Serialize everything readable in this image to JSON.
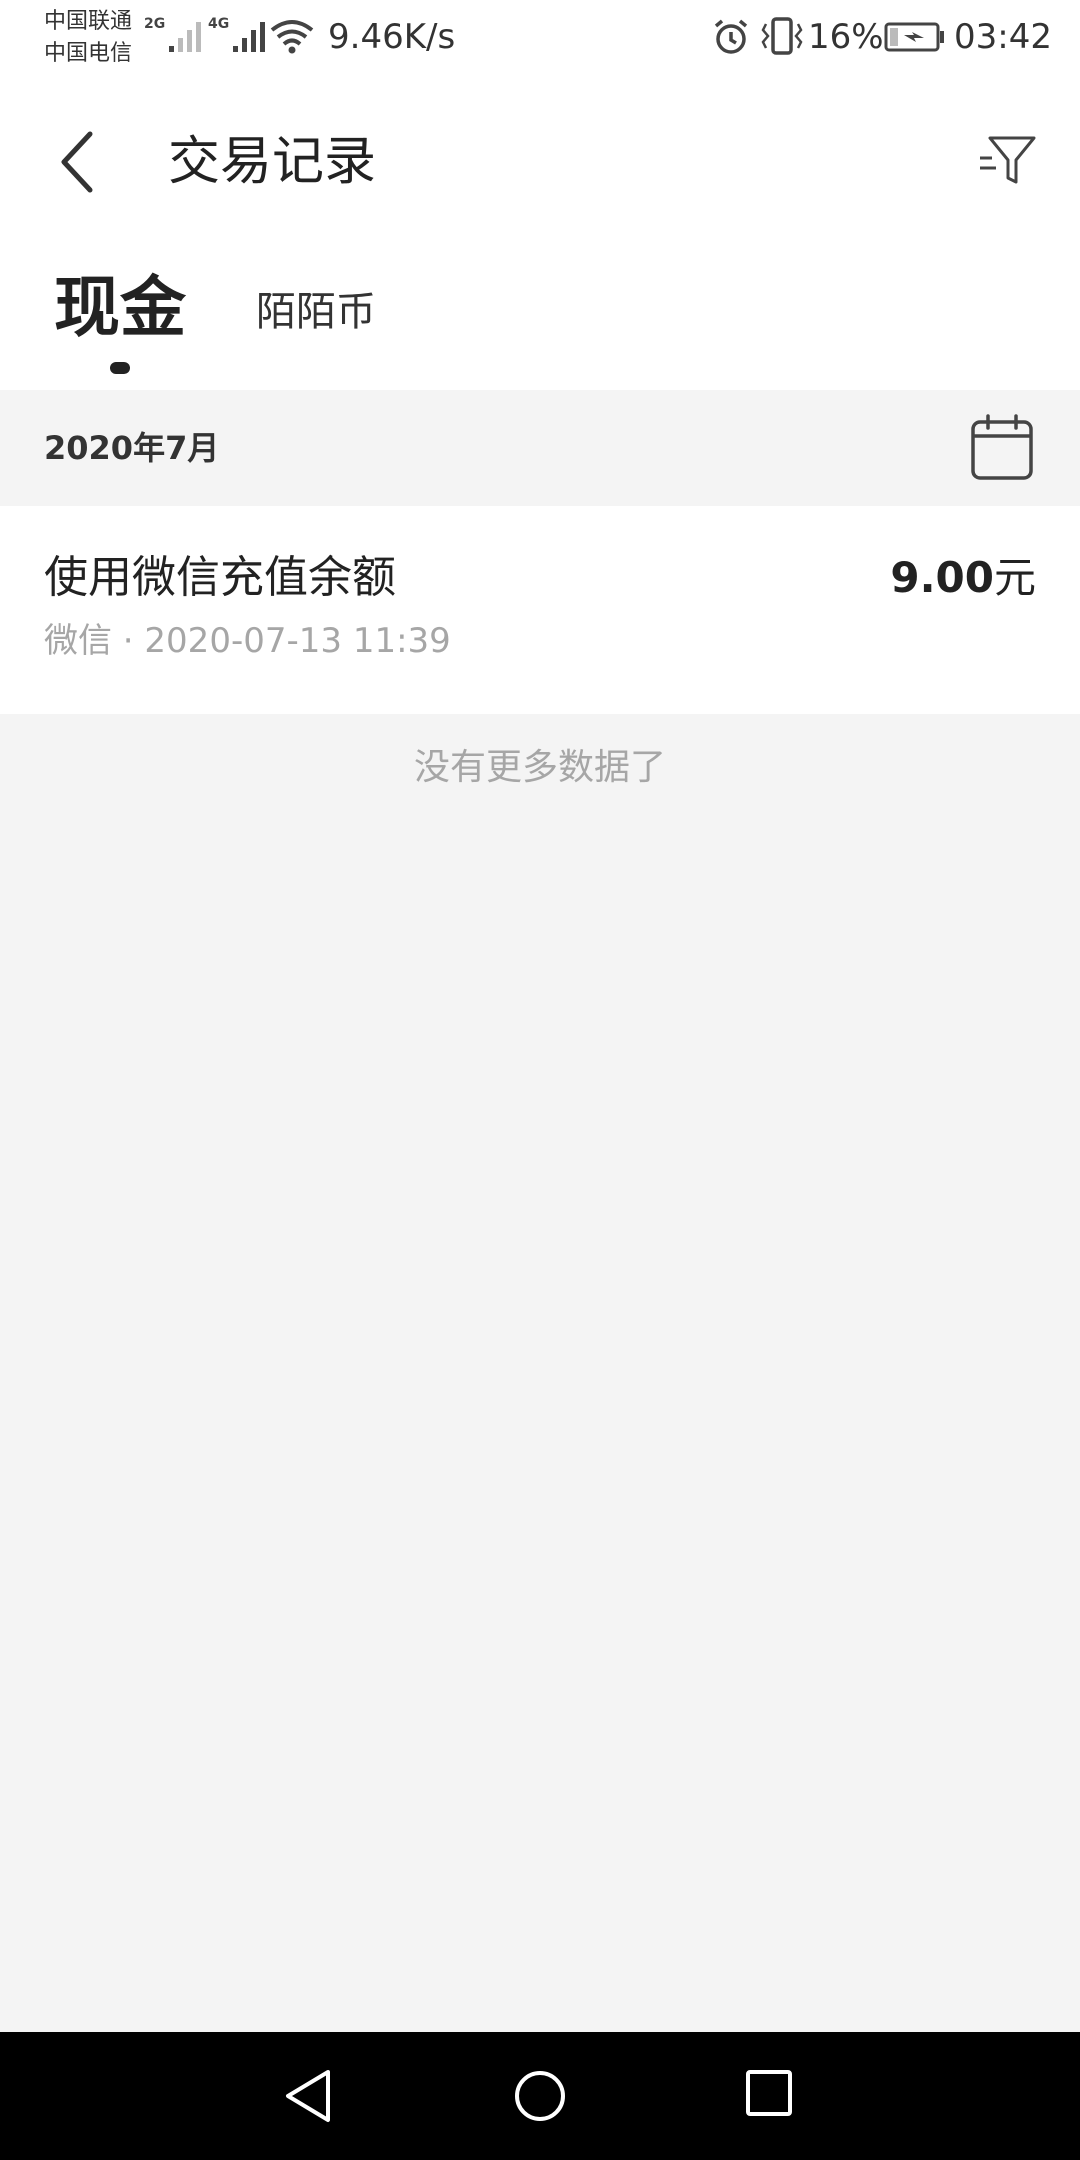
{
  "status_bar": {
    "carrier_1": "中国联通",
    "carrier_2": "中国电信",
    "net_1": "2G",
    "net_2": "4G",
    "speed": "9.46K/s",
    "battery": "16%",
    "time": "03:42",
    "icons": [
      "signal-icon",
      "wifi-icon",
      "alarm-icon",
      "vibrate-icon",
      "battery-charging-icon"
    ]
  },
  "header": {
    "title": "交易记录",
    "back_icon": "chevron-left-icon",
    "filter_icon": "filter-icon"
  },
  "tabs": [
    {
      "label": "现金",
      "active": true
    },
    {
      "label": "陌陌币",
      "active": false
    }
  ],
  "month_section": {
    "label": "2020年7月",
    "calendar_icon": "calendar-icon"
  },
  "transactions": [
    {
      "title": "使用微信充值余额",
      "meta": "微信 · 2020-07-13 11:39",
      "amount_value": "9.00",
      "amount_unit": "元"
    }
  ],
  "footer_text": "没有更多数据了",
  "nav_bar": {
    "icons": [
      "nav-back-icon",
      "nav-home-icon",
      "nav-recents-icon"
    ]
  }
}
